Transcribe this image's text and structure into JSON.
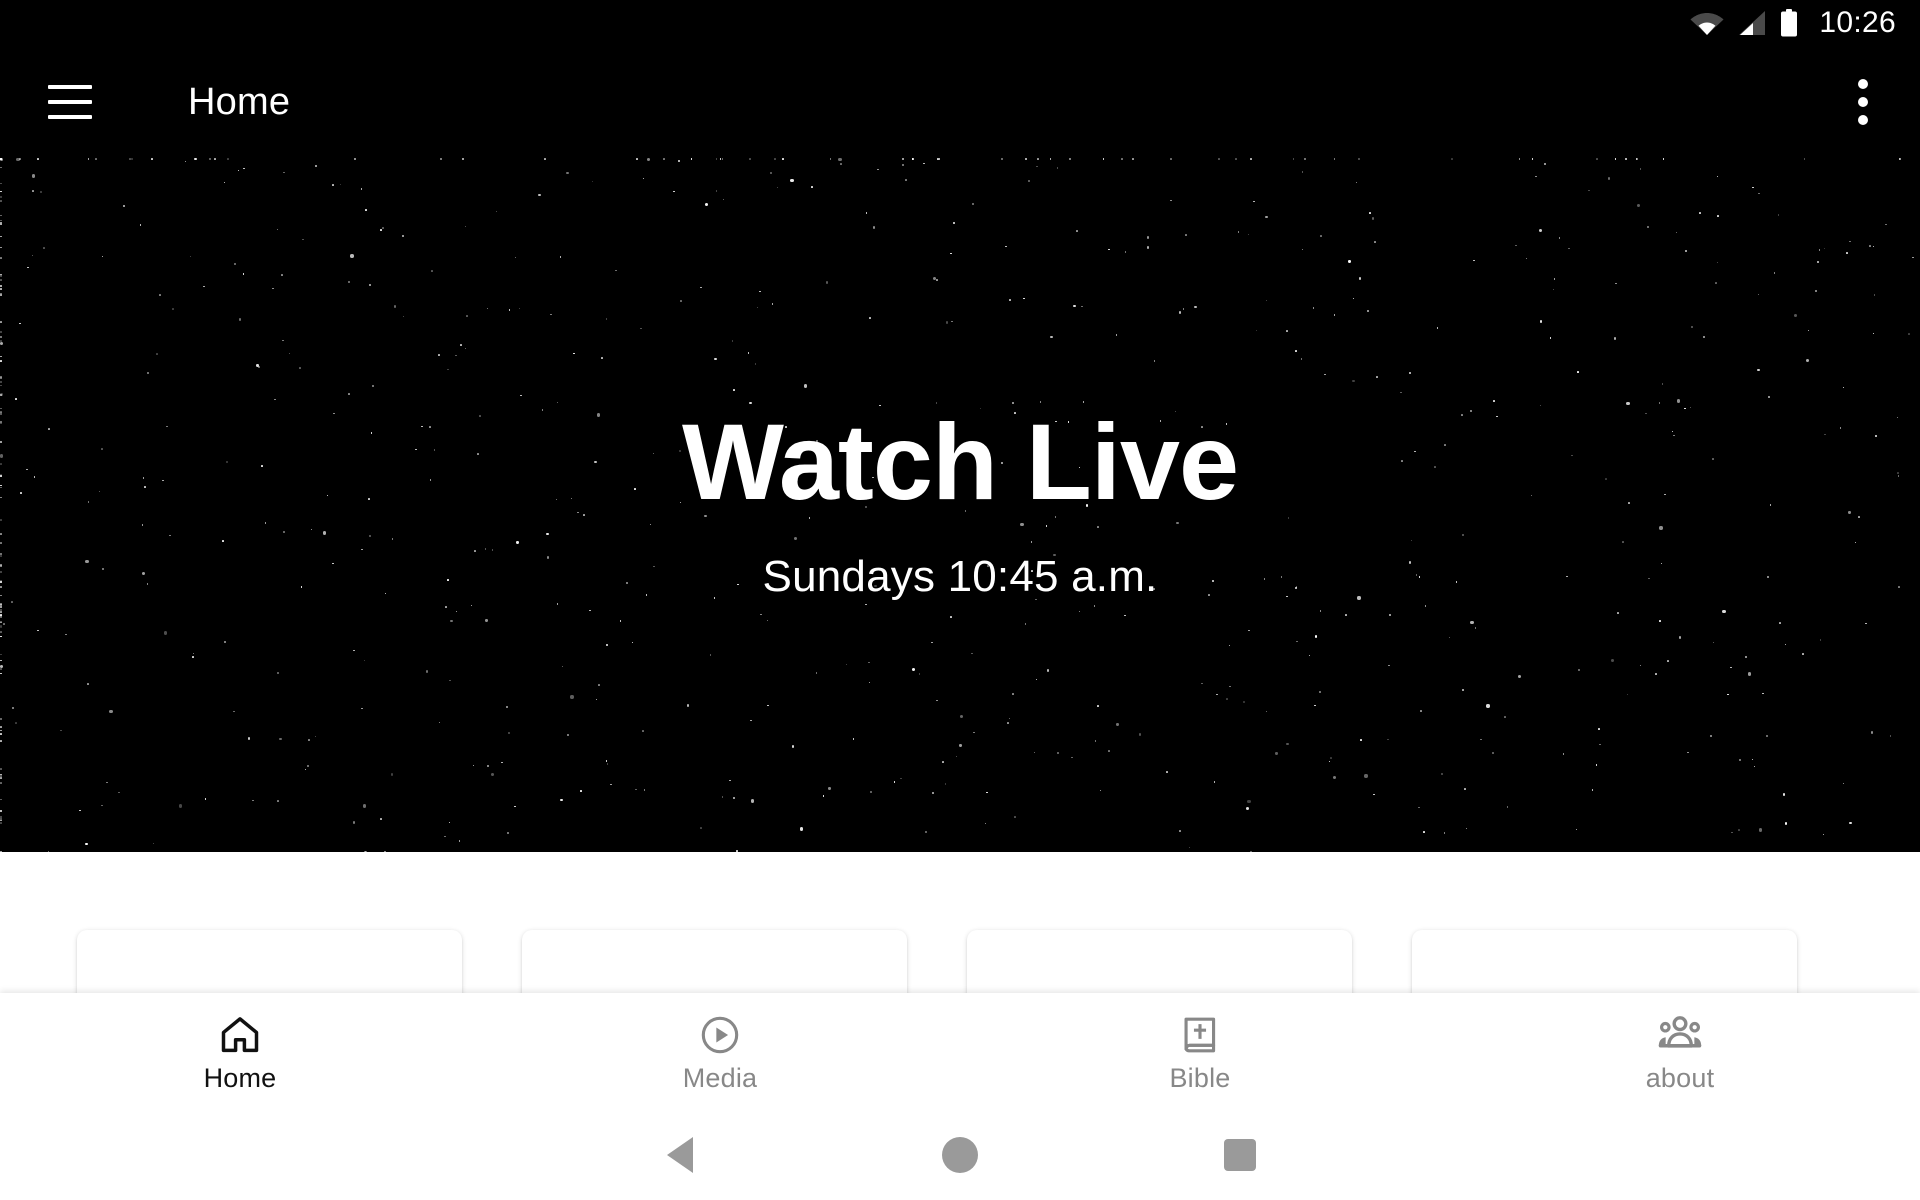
{
  "status_bar": {
    "clock": "10:26",
    "icons": [
      "wifi-icon",
      "cellular-signal-icon",
      "battery-icon"
    ],
    "background_color": "#000000",
    "foreground_color": "#ffffff"
  },
  "app_bar": {
    "menu_icon": "hamburger-menu-icon",
    "title": "Home",
    "overflow_icon": "more-vert-icon",
    "background_color": "#000000",
    "text_color": "#ffffff"
  },
  "hero": {
    "title": "Watch Live",
    "subtitle": "Sundays 10:45 a.m.",
    "background_color": "#000000",
    "text_color": "#ffffff",
    "background_style": "starfield"
  },
  "cards": [
    {
      "id": "card-1",
      "label": ""
    },
    {
      "id": "card-2",
      "label": ""
    },
    {
      "id": "card-3",
      "label": ""
    },
    {
      "id": "card-4",
      "label": ""
    }
  ],
  "tab_bar": {
    "active_color": "#111111",
    "inactive_color": "#888888",
    "tabs": [
      {
        "label": "Home",
        "icon": "home-icon",
        "active": true
      },
      {
        "label": "Media",
        "icon": "play-circle-icon",
        "active": false
      },
      {
        "label": "Bible",
        "icon": "bible-book-icon",
        "active": false
      },
      {
        "label": "about",
        "icon": "people-group-icon",
        "active": false
      }
    ]
  },
  "android_nav": {
    "back_label": "back-button",
    "home_label": "home-button",
    "recents_label": "recents-button",
    "color": "#9a9a9a"
  }
}
